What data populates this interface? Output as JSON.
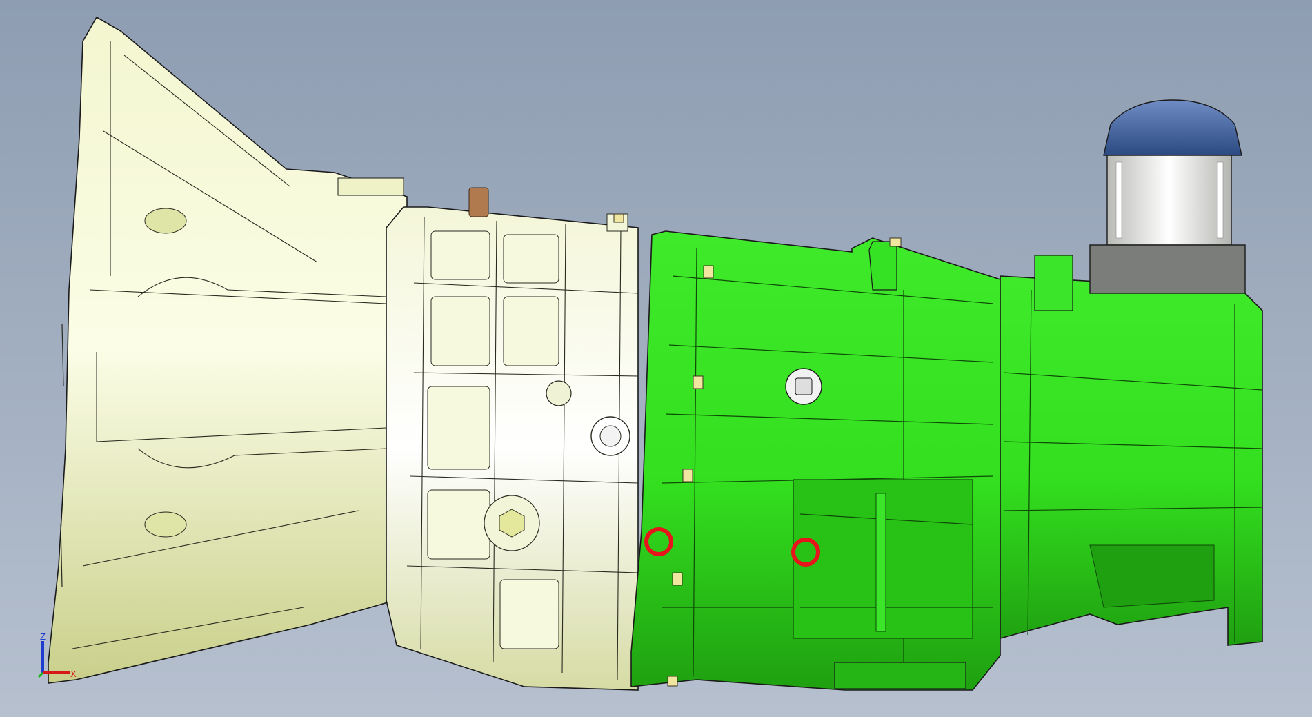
{
  "viewport": {
    "background_top": "#8e9db2",
    "background_bottom": "#b6c0cf"
  },
  "model": {
    "bellhousing_color": "#e9f0b4",
    "main_case_color": "#eef2c6",
    "adapter_housing_color": "#2fe01c",
    "tail_housing_color": "#3ce52a",
    "actuator_cap_color": "#3a5c96",
    "highlight_ring_color": "#e8141c",
    "edge_color": "#1a1a1a"
  },
  "triad": {
    "z_label": "Z",
    "x_label": "X",
    "z_color": "#1e3cd0",
    "x_color": "#d81818",
    "y_color": "#18b418"
  }
}
